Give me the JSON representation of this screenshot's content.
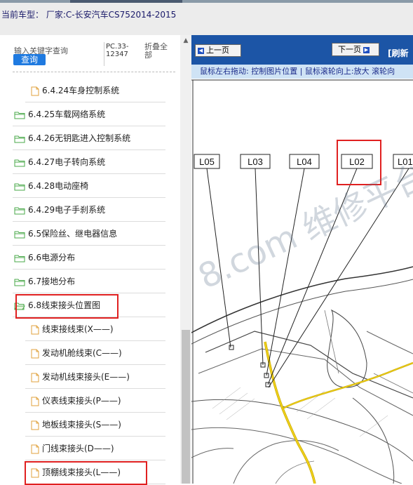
{
  "header": {
    "car_label": "当前车型：",
    "car_value": "厂家:C-长安汽车CS752014-2015"
  },
  "search": {
    "placeholder": "输入关键字查询",
    "button": "查询",
    "code": "PC.33-12347",
    "collapse": "折叠全部"
  },
  "tree": [
    {
      "label": "6.4.24车身控制系统",
      "type": "file"
    },
    {
      "label": "6.4.25车载网络系统",
      "type": "folder"
    },
    {
      "label": "6.4.26无钥匙进入控制系统",
      "type": "folder"
    },
    {
      "label": "6.4.27电子转向系统",
      "type": "folder"
    },
    {
      "label": "6.4.28电动座椅",
      "type": "folder"
    },
    {
      "label": "6.4.29电子手刹系统",
      "type": "folder"
    },
    {
      "label": "6.5保险丝、继电器信息",
      "type": "folder"
    },
    {
      "label": "6.6电源分布",
      "type": "folder"
    },
    {
      "label": "6.7接地分布",
      "type": "folder"
    },
    {
      "label": "6.8线束接头位置图",
      "type": "folder-open"
    },
    {
      "label": "线束接线束(X——)",
      "type": "file"
    },
    {
      "label": "发动机舱线束(C——)",
      "type": "file"
    },
    {
      "label": "发动机线束接头(E——)",
      "type": "file"
    },
    {
      "label": "仪表线束接头(P——)",
      "type": "file"
    },
    {
      "label": "地板线束接头(S——)",
      "type": "file"
    },
    {
      "label": "门线束接头(D——)",
      "type": "file"
    },
    {
      "label": "顶棚线束接头(L——)",
      "type": "file"
    }
  ],
  "viewer": {
    "prev": "上一页",
    "next": "下一页",
    "refresh": "[刷新",
    "hint": "鼠标左右拖动: 控制图片位置 | 鼠标滚轮向上:放大  滚轮向",
    "labels": [
      "L05",
      "L03",
      "L04",
      "L02",
      "L01"
    ],
    "watermark": "8.com 维修平台"
  },
  "colors": {
    "nav": "#1c55a6",
    "hint": "#cfe3f5",
    "highlight": "#e02020",
    "button": "#1f7ae0"
  }
}
